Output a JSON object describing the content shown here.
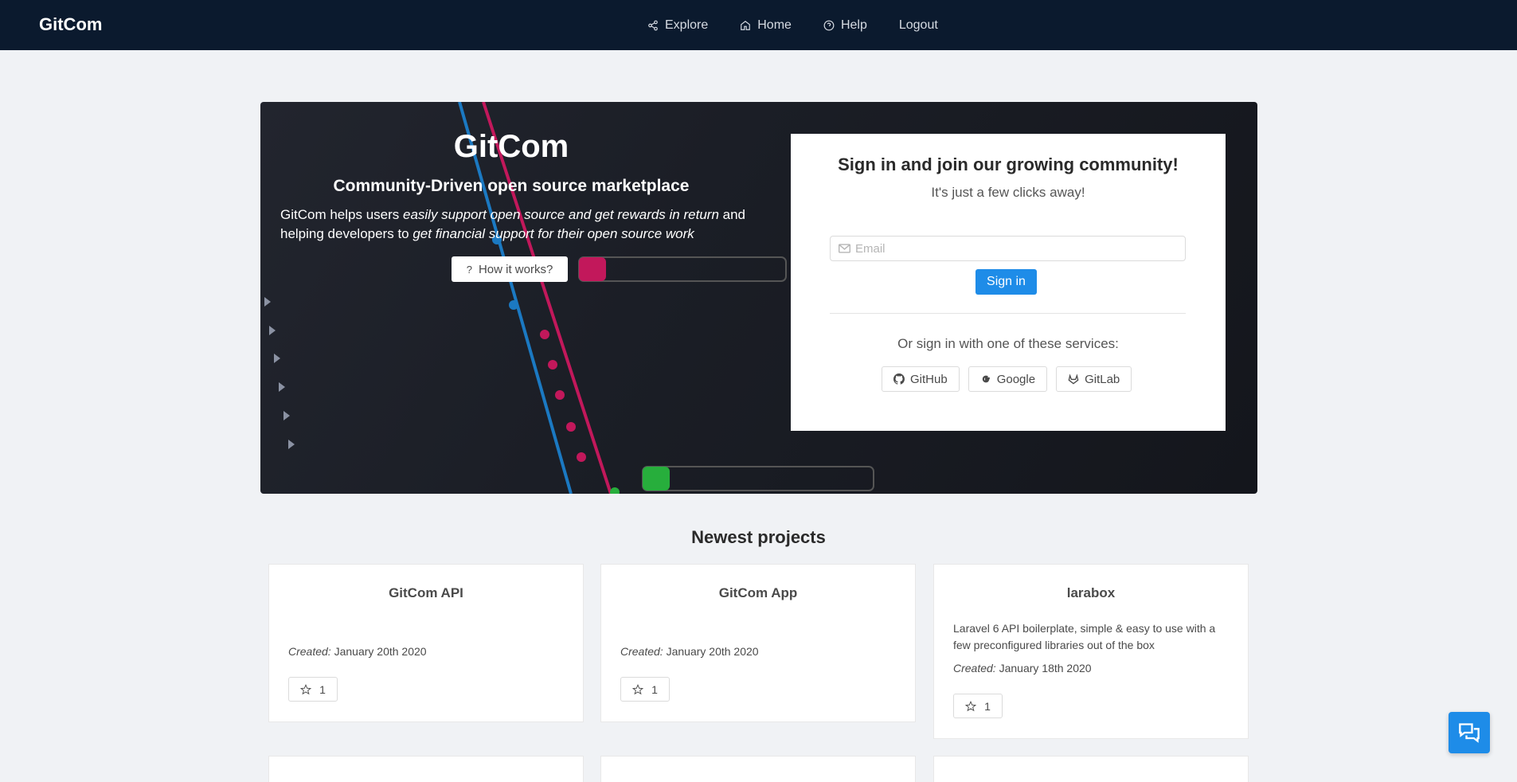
{
  "navbar": {
    "brand": "GitCom",
    "links": [
      {
        "label": "Explore",
        "icon": "share-icon"
      },
      {
        "label": "Home",
        "icon": "home-icon"
      },
      {
        "label": "Help",
        "icon": "help-circle-icon"
      },
      {
        "label": "Logout",
        "icon": ""
      }
    ]
  },
  "hero": {
    "title": "GitCom",
    "subtitle": "Community-Driven open source marketplace",
    "desc_1": "GitCom helps users ",
    "desc_em_1": "easily support open source and get rewards in return",
    "desc_2": " and helping developers to ",
    "desc_em_2": "get financial support for their open source work",
    "how_label": "How it works?"
  },
  "signin": {
    "title": "Sign in and join our growing community!",
    "subtitle": "It's just a few clicks away!",
    "email_placeholder": "Email",
    "button_label": "Sign in",
    "services_text": "Or sign in with one of these services:",
    "services": [
      {
        "label": "GitHub",
        "icon": "github-icon"
      },
      {
        "label": "Google",
        "icon": "google-icon"
      },
      {
        "label": "GitLab",
        "icon": "gitlab-icon"
      }
    ]
  },
  "projects": {
    "title": "Newest projects",
    "created_label": "Created:",
    "items": [
      {
        "name": "GitCom API",
        "description": "",
        "created": "January 20th 2020",
        "stars": "1"
      },
      {
        "name": "GitCom App",
        "description": "",
        "created": "January 20th 2020",
        "stars": "1"
      },
      {
        "name": "larabox",
        "description": "Laravel 6 API boilerplate, simple & easy to use with a few preconfigured libraries out of the box",
        "created": "January 18th 2020",
        "stars": "1"
      }
    ]
  },
  "colors": {
    "navbar": "#0b1a2e",
    "primary": "#1e8ce8",
    "background": "#f0f2f5"
  }
}
